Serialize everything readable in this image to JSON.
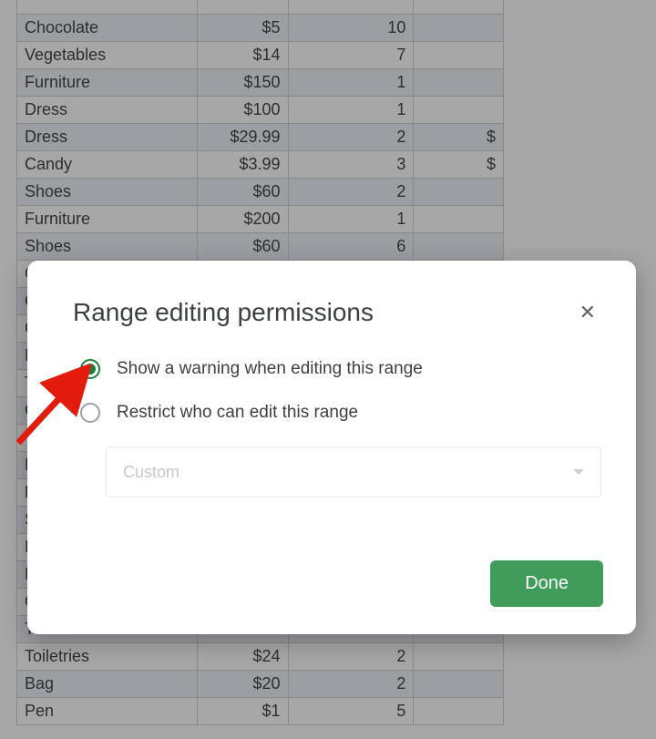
{
  "sheet": {
    "rows": [
      {
        "a": "",
        "b": "",
        "c": "",
        "d": ""
      },
      {
        "a": "Chocolate",
        "b": "$5",
        "c": "10",
        "d": ""
      },
      {
        "a": "Vegetables",
        "b": "$14",
        "c": "7",
        "d": ""
      },
      {
        "a": "Furniture",
        "b": "$150",
        "c": "1",
        "d": ""
      },
      {
        "a": "Dress",
        "b": "$100",
        "c": "1",
        "d": ""
      },
      {
        "a": "Dress",
        "b": "$29.99",
        "c": "2",
        "d": "$"
      },
      {
        "a": "Candy",
        "b": "$3.99",
        "c": "3",
        "d": "$"
      },
      {
        "a": "Shoes",
        "b": "$60",
        "c": "2",
        "d": ""
      },
      {
        "a": "Furniture",
        "b": "$200",
        "c": "1",
        "d": ""
      },
      {
        "a": "Shoes",
        "b": "$60",
        "c": "6",
        "d": ""
      },
      {
        "a": "Ch",
        "b": "",
        "c": "",
        "d": ""
      },
      {
        "a": "Ca",
        "b": "",
        "c": "",
        "d": ""
      },
      {
        "a": "Ca",
        "b": "",
        "c": "",
        "d": ""
      },
      {
        "a": "Dr",
        "b": "",
        "c": "",
        "d": ""
      },
      {
        "a": "To",
        "b": "",
        "c": "",
        "d": ""
      },
      {
        "a": "Ch",
        "b": "",
        "c": "",
        "d": ""
      },
      {
        "a": "Ve",
        "b": "",
        "c": "",
        "d": ""
      },
      {
        "a": "Pe",
        "b": "",
        "c": "",
        "d": ""
      },
      {
        "a": "Pe",
        "b": "",
        "c": "",
        "d": ""
      },
      {
        "a": "Sh",
        "b": "",
        "c": "",
        "d": ""
      },
      {
        "a": "Pe",
        "b": "",
        "c": "",
        "d": ""
      },
      {
        "a": "Fu",
        "b": "",
        "c": "",
        "d": ""
      },
      {
        "a": "Ca",
        "b": "",
        "c": "",
        "d": ""
      },
      {
        "a": "To",
        "b": "",
        "c": "",
        "d": ""
      },
      {
        "a": "Toiletries",
        "b": "$24",
        "c": "2",
        "d": ""
      },
      {
        "a": "Bag",
        "b": "$20",
        "c": "2",
        "d": ""
      },
      {
        "a": "Pen",
        "b": "$1",
        "c": "5",
        "d": ""
      }
    ]
  },
  "dialog": {
    "title": "Range editing permissions",
    "option_warning": "Show a warning when editing this range",
    "option_restrict": "Restrict who can edit this range",
    "dropdown_placeholder": "Custom",
    "done_label": "Done"
  }
}
